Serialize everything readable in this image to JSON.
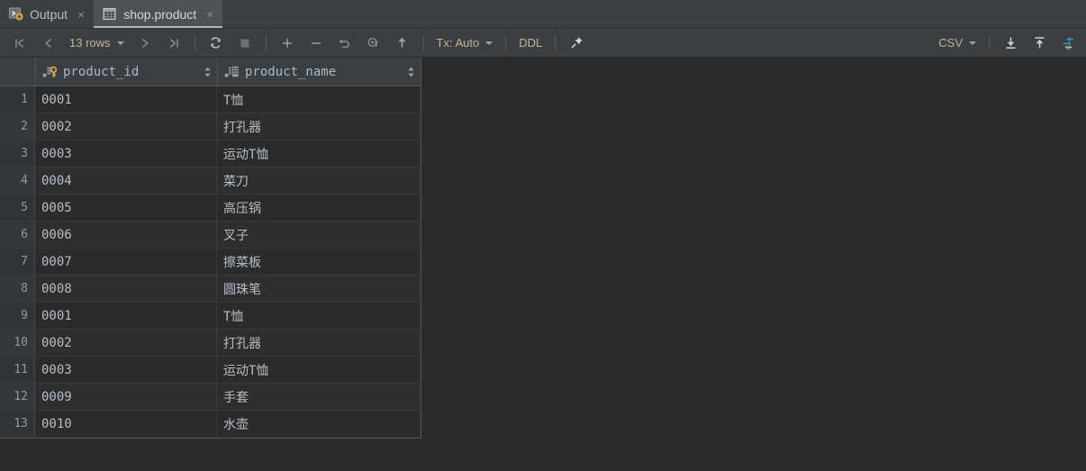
{
  "tabs": [
    {
      "label": "Output",
      "icon": "console-output-icon",
      "close": "×",
      "active": false
    },
    {
      "label": "shop.product",
      "icon": "table-icon",
      "close": "×",
      "active": true
    }
  ],
  "toolbar": {
    "first_page": "first-page-icon",
    "prev_page": "prev-page-icon",
    "rows_label": "13 rows",
    "next_page": "next-page-icon",
    "last_page": "last-page-icon",
    "reload": "refresh-icon",
    "stop": "stop-icon",
    "add_row": "+",
    "remove_row": "−",
    "revert": "undo-icon",
    "revert_selected": "revert-selected-icon",
    "submit": "submit-icon",
    "tx_label": "Tx: Auto",
    "ddl_label": "DDL",
    "pin": "pin-icon",
    "format_label": "CSV",
    "export": "download-icon",
    "import": "upload-icon",
    "data_transfer": "data-transfer-icon",
    "accent_blue": "#3592c4",
    "text_amber": "#c2b596"
  },
  "grid": {
    "columns": [
      {
        "name": "product_id",
        "icon": "primary-key-column-icon"
      },
      {
        "name": "product_name",
        "icon": "text-column-icon"
      }
    ],
    "rows": [
      {
        "n": "1",
        "product_id": "0001",
        "product_name": "T恤"
      },
      {
        "n": "2",
        "product_id": "0002",
        "product_name": "打孔器"
      },
      {
        "n": "3",
        "product_id": "0003",
        "product_name": "运动T恤"
      },
      {
        "n": "4",
        "product_id": "0004",
        "product_name": "菜刀"
      },
      {
        "n": "5",
        "product_id": "0005",
        "product_name": "高压锅"
      },
      {
        "n": "6",
        "product_id": "0006",
        "product_name": "叉子"
      },
      {
        "n": "7",
        "product_id": "0007",
        "product_name": "擦菜板"
      },
      {
        "n": "8",
        "product_id": "0008",
        "product_name": "圆珠笔"
      },
      {
        "n": "9",
        "product_id": "0001",
        "product_name": "T恤"
      },
      {
        "n": "10",
        "product_id": "0002",
        "product_name": "打孔器"
      },
      {
        "n": "11",
        "product_id": "0003",
        "product_name": "运动T恤"
      },
      {
        "n": "12",
        "product_id": "0009",
        "product_name": "手套"
      },
      {
        "n": "13",
        "product_id": "0010",
        "product_name": "水壶"
      }
    ]
  }
}
